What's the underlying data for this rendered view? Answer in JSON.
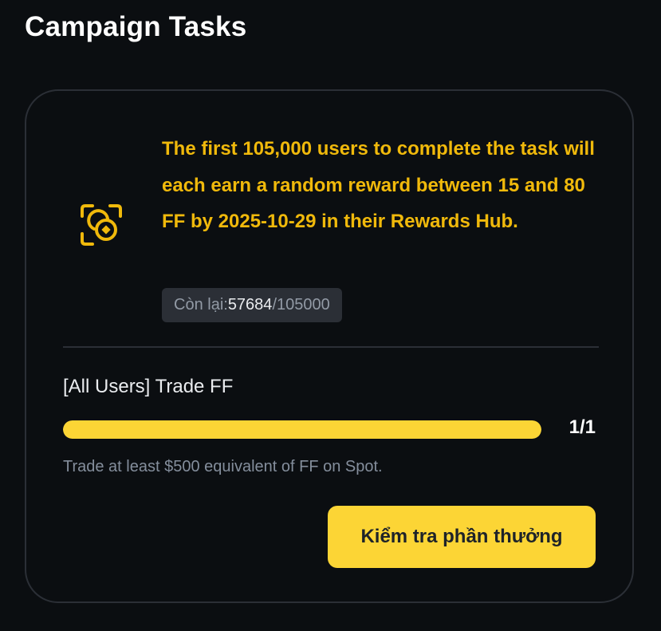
{
  "header": {
    "title": "Campaign Tasks"
  },
  "campaign": {
    "icon": "camera-coin-icon",
    "description": "The first 105,000 users to complete the task will each earn a random reward between 15 and 80 FF by 2025-10-29 in their Rewards Hub.",
    "remaining": {
      "label": "Còn lại: ",
      "current": "57684",
      "total": "/105000"
    }
  },
  "task": {
    "title": "[All Users] Trade FF",
    "progress_fraction": 1,
    "progress_text": "1/1",
    "description": "Trade at least $500 equivalent of FF on Spot.",
    "button_label": "Kiểm tra phần thưởng"
  },
  "colors": {
    "accent": "#f0b90b",
    "button": "#fcd535",
    "background": "#0b0e11",
    "card_border": "#2b2f36"
  }
}
